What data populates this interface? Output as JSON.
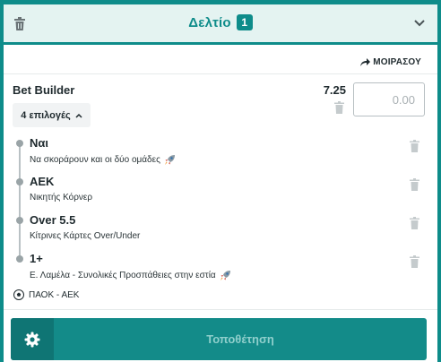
{
  "header": {
    "title": "Δελτίο",
    "count": "1"
  },
  "share": {
    "label": "ΜΟΙΡΑΣΟΥ"
  },
  "bet_builder": {
    "title": "Bet Builder",
    "odds": "7.25",
    "stake_placeholder": "0.00",
    "selections_toggle": "4 επιλογές"
  },
  "legs": [
    {
      "name": "Ναι",
      "desc": "Να σκοράρουν και οι δύο ομάδες",
      "boost_icon": "rocket-icon"
    },
    {
      "name": "ΑΕΚ",
      "desc": "Νικητής Κόρνερ"
    },
    {
      "name": "Over 5.5",
      "desc": "Κίτρινες Κάρτες Over/Under"
    },
    {
      "name": "1+",
      "desc": "Ε. Λαμέλα - Συνολικές Προσπάθειες στην εστία",
      "boost_icon": "rocket-icon"
    }
  ],
  "match": {
    "label": "ΠΑΟΚ - ΑΕΚ",
    "icon": "soccer-ball-icon"
  },
  "place_bet": {
    "label": "Τοποθέτηση",
    "settings_icon": "gear-icon"
  },
  "colors": {
    "accent": "#0e8c8a",
    "header_bg": "#e4f3f1",
    "button_bg": "#138b89",
    "button_dark": "#0f7574",
    "button_text": "#8fcfcc"
  }
}
